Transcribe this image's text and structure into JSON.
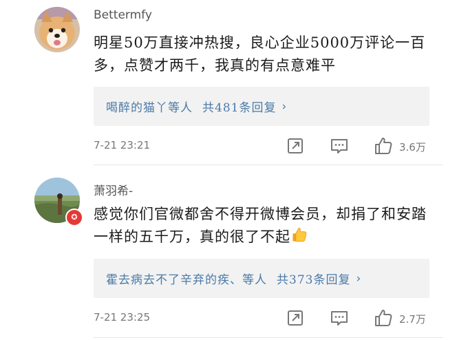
{
  "comments": [
    {
      "username": "Bettermfy",
      "text": "明星50万直接冲热搜，良心企业5000万评论一百多，点赞才两千，我真的有点意难平",
      "reply_who": "喝醉的猫丫等人",
      "reply_count": "共481条回复",
      "chevron": "›",
      "timestamp": "7-21 23:21",
      "likes": "3.6万",
      "avatar_icon": "dog-avatar"
    },
    {
      "username": "萧羽希-",
      "text": "感觉你们官微都舍不得开微博会员，却捐了和安踏一样的五千万，真的很了不起",
      "emoji": "thumbs-up-emoji",
      "reply_who": "霍去病去不了辛弃的疾、等人",
      "reply_count": "共373条回复",
      "chevron": "›",
      "timestamp": "7-21 23:25",
      "likes": "2.7万",
      "avatar_icon": "landscape-avatar",
      "badge_icon": "verified-badge-icon"
    }
  ],
  "colors": {
    "link": "#4a7aa8",
    "reply_bg": "#f2f2f2",
    "meta": "#777777",
    "badge": "#e53935"
  }
}
